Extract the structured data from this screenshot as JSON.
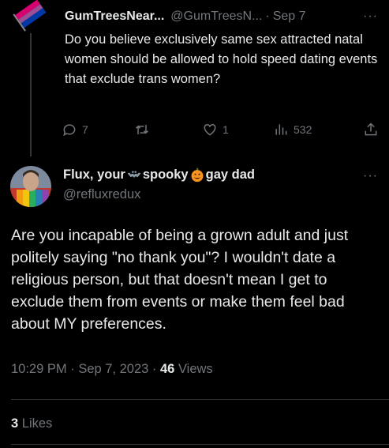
{
  "parent_tweet": {
    "display_name": "GumTreesNear...",
    "handle": "@GumTreesN...",
    "date": "Sep 7",
    "more": "···",
    "text": "Do you believe exclusively same sex attracted natal women should be allowed to hold speed dating events that exclude trans women?",
    "replies": "7",
    "retweets": "",
    "likes": "1",
    "views": "532"
  },
  "main_tweet": {
    "display_name_part1": "Flux, your ",
    "display_name_part2": "spooky",
    "display_name_part3": " gay dad",
    "handle": "@refluxredux",
    "more": "···",
    "text": "Are you incapable of being a grown adult and just politely saying \"no thank you\"? I wouldn't date a religious person, but that doesn't mean I get to exclude them from events or make them feel bad about MY preferences.",
    "time": "10:29 PM",
    "date": "Sep 7, 2023",
    "view_count": "46",
    "views_label": "Views",
    "like_count": "3",
    "likes_label": "Likes"
  },
  "icons": [
    "reply-icon",
    "retweet-icon",
    "like-icon",
    "views-icon",
    "share-icon",
    "bat-emoji",
    "pumpkin-emoji",
    "more-icon"
  ],
  "colors": {
    "background": "#000000",
    "text": "#e7e9ea",
    "secondary": "#71767b",
    "divider": "#2f3336"
  }
}
